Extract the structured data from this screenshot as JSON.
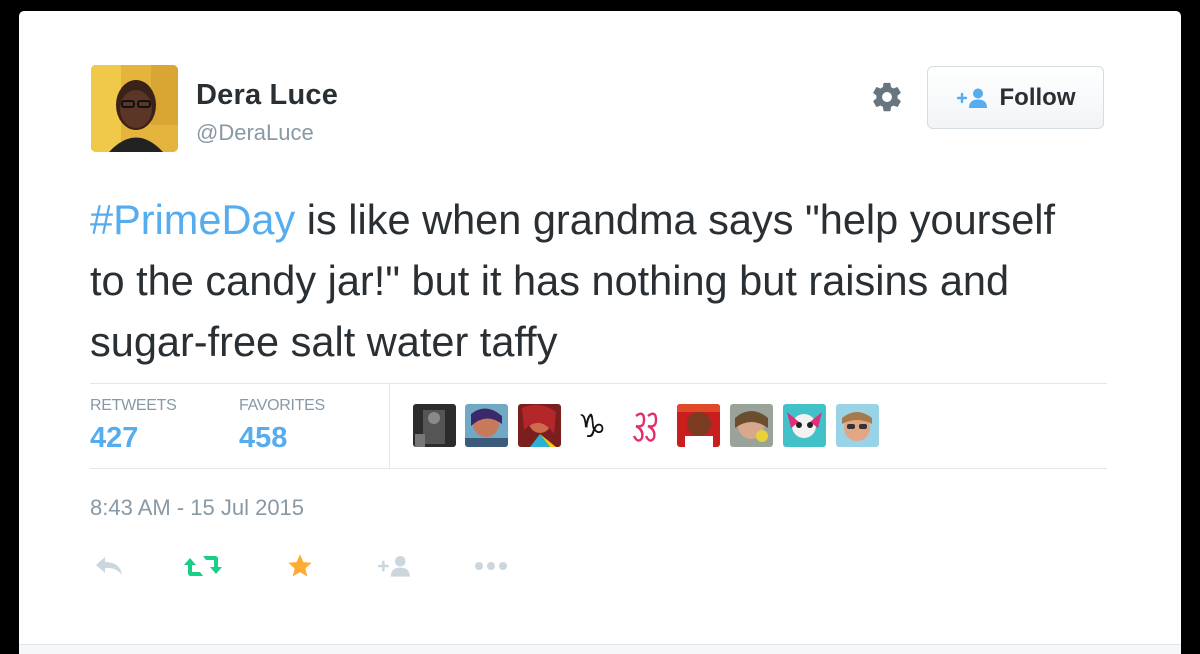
{
  "user": {
    "display_name": "Dera Luce",
    "username": "@DeraLuce"
  },
  "header": {
    "follow_label": "Follow"
  },
  "tweet": {
    "hashtag": "#PrimeDay",
    "text": " is like when grandma says \"help yourself to the candy jar!\" but it has nothing but raisins and sugar-free salt water taffy"
  },
  "stats": {
    "retweets_label": "RETWEETS",
    "retweets_count": "427",
    "favorites_label": "FAVORITES",
    "favorites_count": "458"
  },
  "timestamp": "8:43 AM - 15 Jul 2015",
  "colors": {
    "link_blue": "#55acee",
    "retweet_green": "#19cf86",
    "favorite_gold": "#ffac33",
    "muted_gray": "#8899a6",
    "text_dark": "#292f33"
  },
  "icons": {
    "settings": "gear-icon",
    "follow": "add-user-icon",
    "reply": "reply-icon",
    "retweet": "retweet-icon",
    "favorite": "star-icon",
    "follow_action": "add-user-icon",
    "more": "more-icon"
  }
}
